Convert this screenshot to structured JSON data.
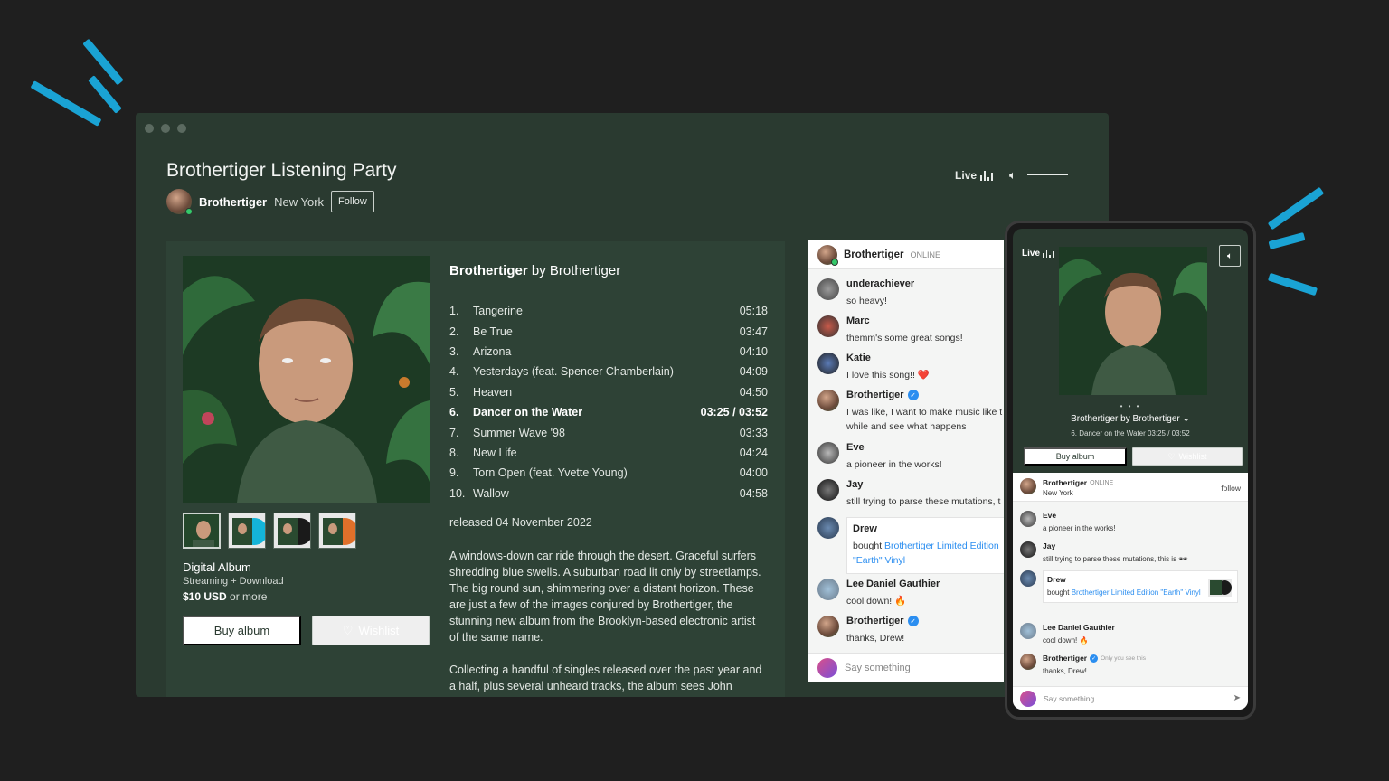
{
  "window": {
    "title": "Brothertiger Listening Party",
    "artist": {
      "name": "Brothertiger",
      "location": "New York",
      "follow_label": "Follow"
    },
    "live_label": "Live"
  },
  "album": {
    "heading_title": "Brothertiger",
    "heading_by": "by Brothertiger",
    "format_title": "Digital Album",
    "format_sub": "Streaming + Download",
    "price": "$10 USD",
    "price_suffix": "or more",
    "buy_label": "Buy album",
    "wishlist_label": "Wishlist",
    "released": "released 04 November 2022",
    "description": "A windows-down car ride through the desert. Graceful surfers shredding blue swells. A suburban road lit only by streetlamps. The big round sun, shimmering over a distant horizon. These are just a few of the images conjured by Brothertiger, the stunning new album from the Brooklyn-based electronic artist of the same name.",
    "description2": "Collecting a handful of singles released over the past year and a half, plus several unheard tracks, the album sees John Jagos,",
    "tracks": [
      {
        "num": "1.",
        "name": "Tangerine",
        "duration": "05:18"
      },
      {
        "num": "2.",
        "name": "Be True",
        "duration": "03:47"
      },
      {
        "num": "3.",
        "name": "Arizona",
        "duration": "04:10"
      },
      {
        "num": "4.",
        "name": "Yesterdays (feat. Spencer Chamberlain)",
        "duration": "04:09"
      },
      {
        "num": "5.",
        "name": "Heaven",
        "duration": "04:50"
      },
      {
        "num": "6.",
        "name": "Dancer on the Water",
        "duration": "03:25 / 03:52"
      },
      {
        "num": "7.",
        "name": "Summer Wave '98",
        "duration": "03:33"
      },
      {
        "num": "8.",
        "name": "New Life",
        "duration": "04:24"
      },
      {
        "num": "9.",
        "name": "Torn Open (feat. Yvette Young)",
        "duration": "04:00"
      },
      {
        "num": "10.",
        "name": "Wallow",
        "duration": "04:58"
      }
    ]
  },
  "chat": {
    "host_name": "Brothertiger",
    "host_status": "ONLINE",
    "messages": [
      {
        "who": "underachiever",
        "text": "so heavy!"
      },
      {
        "who": "Marc",
        "text": "themm's some great songs!"
      },
      {
        "who": "Katie",
        "text": "I love this song!! ❤️"
      },
      {
        "who": "Brothertiger",
        "text": "I was like, I want to make music like t",
        "text2": "while and see what happens"
      },
      {
        "who": "Eve",
        "text": "a pioneer in the works!"
      },
      {
        "who": "Jay",
        "text": "still trying to parse these mutations, t"
      },
      {
        "who": "Drew",
        "text": "bought",
        "link": "Brothertiger Limited Edition",
        "link2": "\"Earth\" Vinyl"
      },
      {
        "who": "Lee Daniel Gauthier",
        "text": "cool down! 🔥"
      },
      {
        "who": "Brothertiger",
        "text": "thanks, Drew!"
      }
    ],
    "placeholder": "Say something"
  },
  "phone": {
    "live_label": "Live",
    "pager": "• • •",
    "album_line": "Brothertiger by Brothertiger ⌄",
    "track_line": "6.  Dancer on the Water   03:25 / 03:52",
    "buy_label": "Buy album",
    "wishlist_label": "Wishlist",
    "host_name": "Brothertiger",
    "host_status": "ONLINE",
    "host_location": "New York",
    "follow_label": "follow",
    "messages": [
      {
        "who": "Eve",
        "text": "a pioneer in the works!"
      },
      {
        "who": "Jay",
        "text": "still trying to parse these mutations, this is 🕶"
      },
      {
        "who": "Drew",
        "text": "bought",
        "link": "Brothertiger Limited Edition \"Earth\"",
        "link2": "Vinyl"
      },
      {
        "who": "Lee Daniel Gauthier",
        "text": "cool down! 🔥"
      },
      {
        "who": "Brothertiger",
        "note": "Only you see this",
        "text": "thanks, Drew!"
      }
    ],
    "placeholder": "Say something"
  },
  "colors": {
    "accent_dashes": "#1aa3d4",
    "window_bg": "#2a3a30",
    "verified": "#2b8ef0",
    "online": "#34c96a"
  }
}
